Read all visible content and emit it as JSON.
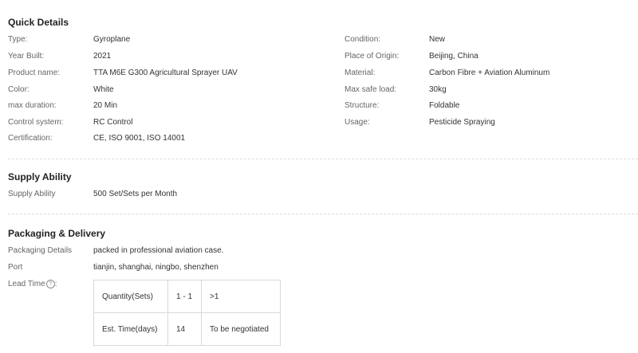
{
  "quick_details": {
    "title": "Quick Details",
    "left": [
      {
        "label": "Type:",
        "value": "Gyroplane"
      },
      {
        "label": "Year Built:",
        "value": "2021"
      },
      {
        "label": "Product name:",
        "value": "TTA M6E G300 Agricultural Sprayer UAV"
      },
      {
        "label": "Color:",
        "value": "White"
      },
      {
        "label": "max duration:",
        "value": "20 Min"
      },
      {
        "label": "Control system:",
        "value": "RC Control"
      },
      {
        "label": "Certification:",
        "value": "CE, ISO 9001, ISO 14001"
      }
    ],
    "right": [
      {
        "label": "Condition:",
        "value": "New"
      },
      {
        "label": "Place of Origin:",
        "value": "Beijing, China"
      },
      {
        "label": "Material:",
        "value": "Carbon Fibre + Aviation Aluminum"
      },
      {
        "label": "Max safe load:",
        "value": "30kg"
      },
      {
        "label": "Structure:",
        "value": "Foldable"
      },
      {
        "label": "Usage:",
        "value": "Pesticide Spraying"
      }
    ]
  },
  "supply_ability": {
    "title": "Supply Ability",
    "label": "Supply Ability",
    "value": "500 Set/Sets per Month"
  },
  "packaging": {
    "title": "Packaging & Delivery",
    "details_label": "Packaging Details",
    "details_value": "packed in professional aviation case.",
    "port_label": "Port",
    "port_value": "tianjin, shanghai, ningbo, shenzhen",
    "lead_time_label": "Lead Time",
    "lead_time_suffix": ":",
    "help_icon_glyph": "?",
    "lead_table": {
      "rows": [
        [
          "Quantity(Sets)",
          "1 - 1",
          ">1"
        ],
        [
          "Est. Time(days)",
          "14",
          "To be negotiated"
        ]
      ]
    }
  }
}
